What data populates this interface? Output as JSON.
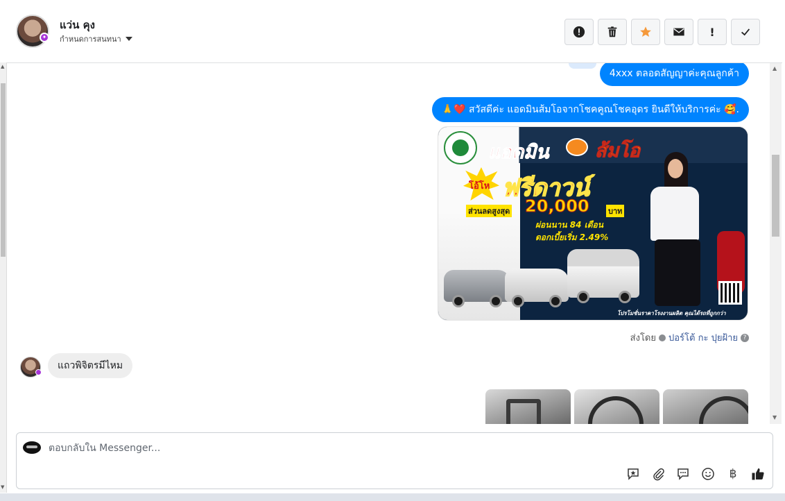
{
  "header": {
    "contact_name": "แว่น คุง",
    "assign_label": "กำหนดการสนทนา"
  },
  "toolbar": {
    "buttons": [
      {
        "icon": "alert-circle-icon",
        "name": "report-button"
      },
      {
        "icon": "trash-icon",
        "name": "delete-button"
      },
      {
        "icon": "star-icon",
        "name": "star-button"
      },
      {
        "icon": "mail-icon",
        "name": "mark-unread-button"
      },
      {
        "icon": "exclamation-icon",
        "name": "follow-up-button"
      },
      {
        "icon": "check-icon",
        "name": "mark-done-button"
      }
    ],
    "star_color": "#f5993b"
  },
  "messages": {
    "out1": "4xxx  ตลอดสัญญาค่ะคุณลูกค้า",
    "out2": "🙏❤️ สวัสดีค่ะ แอดมินส้มโอจากโชคคูณโชคอุดร ยินดีให้บริการค่ะ  🥰.",
    "promo": {
      "title_a": "แอดมิน",
      "title_b": "ส้มโอ",
      "burst": "โอ้โห",
      "headline": "ฟรีดาวน์",
      "discount_label": "ส่วนลดสูงสุด",
      "discount_amount": "20,000",
      "discount_unit": "บาท",
      "line1": "ผ่อนนาน 84 เดือน",
      "line2": "ดอกเบี้ยเริ่ม 2.49%",
      "footer": "โปรโมชั่นราคาโรงงานผลิต คุณได้รถที่ถูกกว่า"
    },
    "sent_by_label": "ส่งโดย",
    "sent_by_name": "ปอร์โต้ กะ ปุยฝ้าย",
    "in1": "แถวพิจิตรมีไหม"
  },
  "composer": {
    "placeholder": "ตอบกลับใน Messenger...",
    "baht_symbol": "฿"
  },
  "colors": {
    "accent": "#0084ff",
    "incoming_bubble": "#eeeeee"
  }
}
